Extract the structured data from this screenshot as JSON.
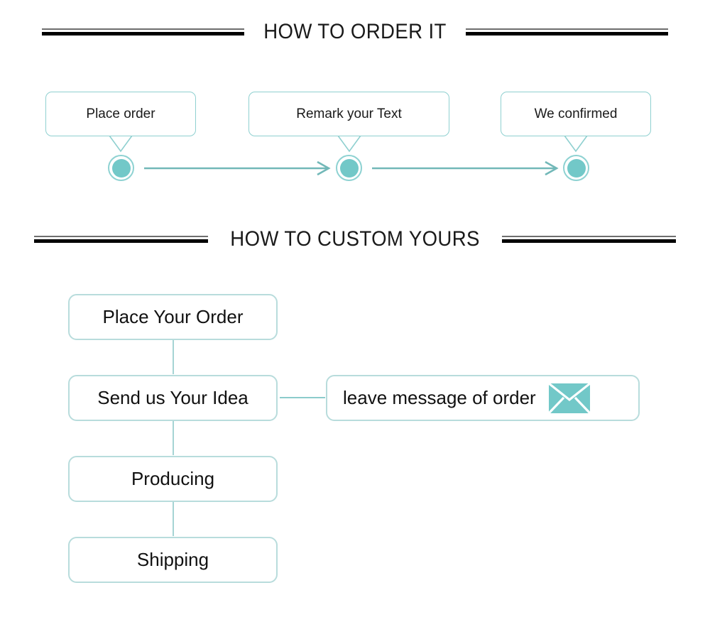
{
  "colors": {
    "teal_fill": "#72c8c8",
    "teal_border": "#8fd0d0",
    "teal_light_border": "#b8dcdc",
    "connector": "#a5d4d4",
    "rule_thin": "#6e6e6e",
    "rule_thick": "#000000",
    "text": "#111111",
    "background": "#ffffff"
  },
  "sections": [
    {
      "heading": "HOW TO ORDER IT",
      "steps": [
        {
          "label": "Place order"
        },
        {
          "label": "Remark your Text"
        },
        {
          "label": "We confirmed"
        }
      ],
      "connector_icon": "arrow-right-icon",
      "node_icon": "circle-node-icon"
    },
    {
      "heading": "HOW TO CUSTOM YOURS",
      "steps": [
        {
          "label": "Place Your Order"
        },
        {
          "label": "Send us Your Idea"
        },
        {
          "label": "Producing"
        },
        {
          "label": "Shipping"
        }
      ],
      "side_note": {
        "label": "leave message of order",
        "icon": "envelope-icon"
      }
    }
  ]
}
